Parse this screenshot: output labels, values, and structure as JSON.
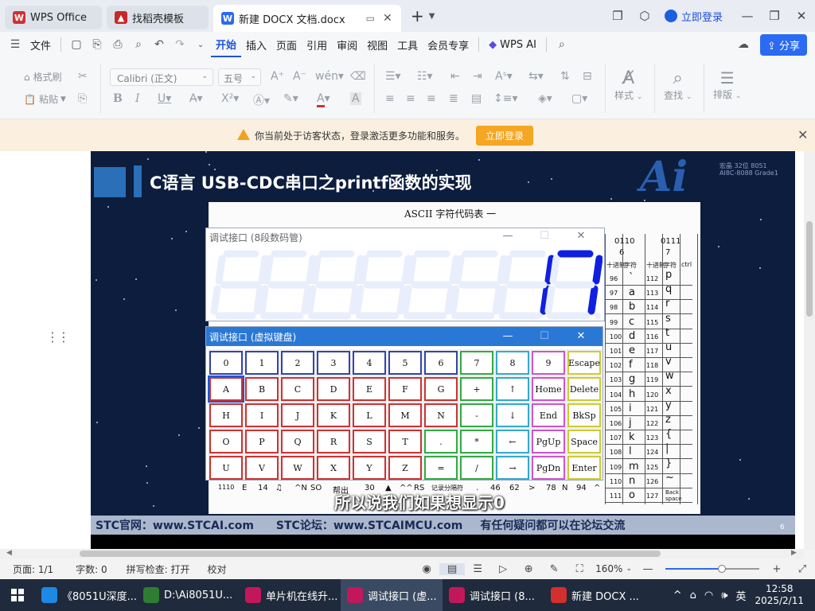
{
  "titlebar": {
    "tabs": [
      {
        "label": "WPS Office",
        "icon": "wps-logo-icon",
        "color": "#d32f2f"
      },
      {
        "label": "找稻壳模板",
        "icon": "docer-icon",
        "color": "#c62828"
      },
      {
        "label": "新建 DOCX 文档.docx",
        "icon": "word-doc-icon",
        "color": "#2b6bf3"
      }
    ],
    "new_tab": "+",
    "login": "立即登录"
  },
  "menu": {
    "file": "文件",
    "items": [
      "开始",
      "插入",
      "页面",
      "引用",
      "审阅",
      "视图",
      "工具",
      "会员专享"
    ],
    "wps_ai": "WPS AI",
    "share": "分享"
  },
  "ribbon": {
    "format_painter": "格式刷",
    "paste": "粘贴",
    "font": "Calibri (正文)",
    "font_size": "五号",
    "styles": "样式",
    "find": "查找",
    "layout": "排版"
  },
  "notice": {
    "text": "你当前处于访客状态，登录激活更多功能和服务。",
    "button": "立即登录"
  },
  "video": {
    "title": "C语言 USB-CDC串口之printf函数的实现",
    "logo": "Ai",
    "logo_sub_1": "宏晶 32位 8051",
    "logo_sub_2": "AI8C-8088 Grade1",
    "ascii_title": "ASCII  字符代码表  一",
    "subtitle": "所以说我们如果想显示0",
    "footer_1": "STC官网：www.STCAI.com",
    "footer_2": "STC论坛：www.STCAIMCU.com",
    "footer_3": "有任何疑问都可以在论坛交流",
    "page_number": "6",
    "ascii_right": {
      "h1": "0110",
      "h2": "0111",
      "h3": "6",
      "h4": "7",
      "hdr": [
        "十进制",
        "字符",
        "十进制",
        "字符",
        "ctrl"
      ],
      "rows": [
        [
          "96",
          "`",
          "112",
          "p"
        ],
        [
          "97",
          "a",
          "113",
          "q"
        ],
        [
          "98",
          "b",
          "114",
          "r"
        ],
        [
          "99",
          "c",
          "115",
          "s"
        ],
        [
          "100",
          "d",
          "116",
          "t"
        ],
        [
          "101",
          "e",
          "117",
          "u"
        ],
        [
          "102",
          "f",
          "118",
          "v"
        ],
        [
          "103",
          "g",
          "119",
          "w"
        ],
        [
          "104",
          "h",
          "120",
          "x"
        ],
        [
          "105",
          "i",
          "121",
          "y"
        ],
        [
          "106",
          "j",
          "122",
          "z"
        ],
        [
          "107",
          "k",
          "123",
          "{"
        ],
        [
          "108",
          "l",
          "124",
          "|"
        ],
        [
          "109",
          "m",
          "125",
          "}"
        ],
        [
          "110",
          "n",
          "126",
          "~"
        ],
        [
          "111",
          "o",
          "127",
          "Back space"
        ]
      ]
    },
    "ascii_bottom": [
      "1110",
      "E",
      "14",
      "♫",
      "^N",
      "SO",
      "帮出",
      "30",
      "▲",
      "^^",
      "RS",
      "记录分隔符",
      ".",
      "46",
      "62",
      ">",
      "78",
      "N",
      "94",
      "^"
    ]
  },
  "seg_window": {
    "title": "调试接口 (8段数码管)",
    "minimize": "—",
    "maximize": "☐",
    "close": "✕",
    "display_value": "17",
    "lit_color": "#1020e0",
    "unlit_color": "#e8eefc"
  },
  "kbd_window": {
    "title": "调试接口 (虚拟键盘)",
    "minimize": "—",
    "maximize": "☐",
    "close": "✕",
    "rows": [
      [
        "0",
        "1",
        "2",
        "3",
        "4",
        "5",
        "6",
        "7",
        "8",
        "9",
        "Escape"
      ],
      [
        "A",
        "B",
        "C",
        "D",
        "E",
        "F",
        "G",
        "+",
        "↑",
        "Home",
        "Delete"
      ],
      [
        "H",
        "I",
        "J",
        "K",
        "L",
        "M",
        "N",
        "-",
        "↓",
        "End",
        "BkSp"
      ],
      [
        "O",
        "P",
        "Q",
        "R",
        "S",
        "T",
        ".",
        "*",
        "←",
        "PgUp",
        "Space"
      ],
      [
        "U",
        "V",
        "W",
        "X",
        "Y",
        "Z",
        "=",
        "/",
        "→",
        "PgDn",
        "Enter"
      ]
    ]
  },
  "status": {
    "page": "页面: 1/1",
    "words": "字数: 0",
    "spell": "拼写检查: 打开",
    "proof": "校对",
    "zoom": "160%",
    "zoom_level": 0.6
  },
  "taskbar": {
    "apps": [
      {
        "label": "《8051U深度...",
        "icon": "edge-icon",
        "color": "#1e88e5"
      },
      {
        "label": "D:\\Ai8051U...",
        "icon": "keil-icon",
        "color": "#2e7d32"
      },
      {
        "label": "单片机在线升...",
        "icon": "stc-isp-icon",
        "color": "#c2185b"
      },
      {
        "label": "调试接口 (虚...",
        "icon": "stc-isp-icon",
        "color": "#c2185b"
      },
      {
        "label": "调试接口 (8...",
        "icon": "stc-isp-icon",
        "color": "#c2185b"
      },
      {
        "label": "新建 DOCX ...",
        "icon": "wps-logo-icon",
        "color": "#d32f2f"
      }
    ],
    "ime": "英",
    "time": "12:58",
    "date": "2025/2/11"
  }
}
